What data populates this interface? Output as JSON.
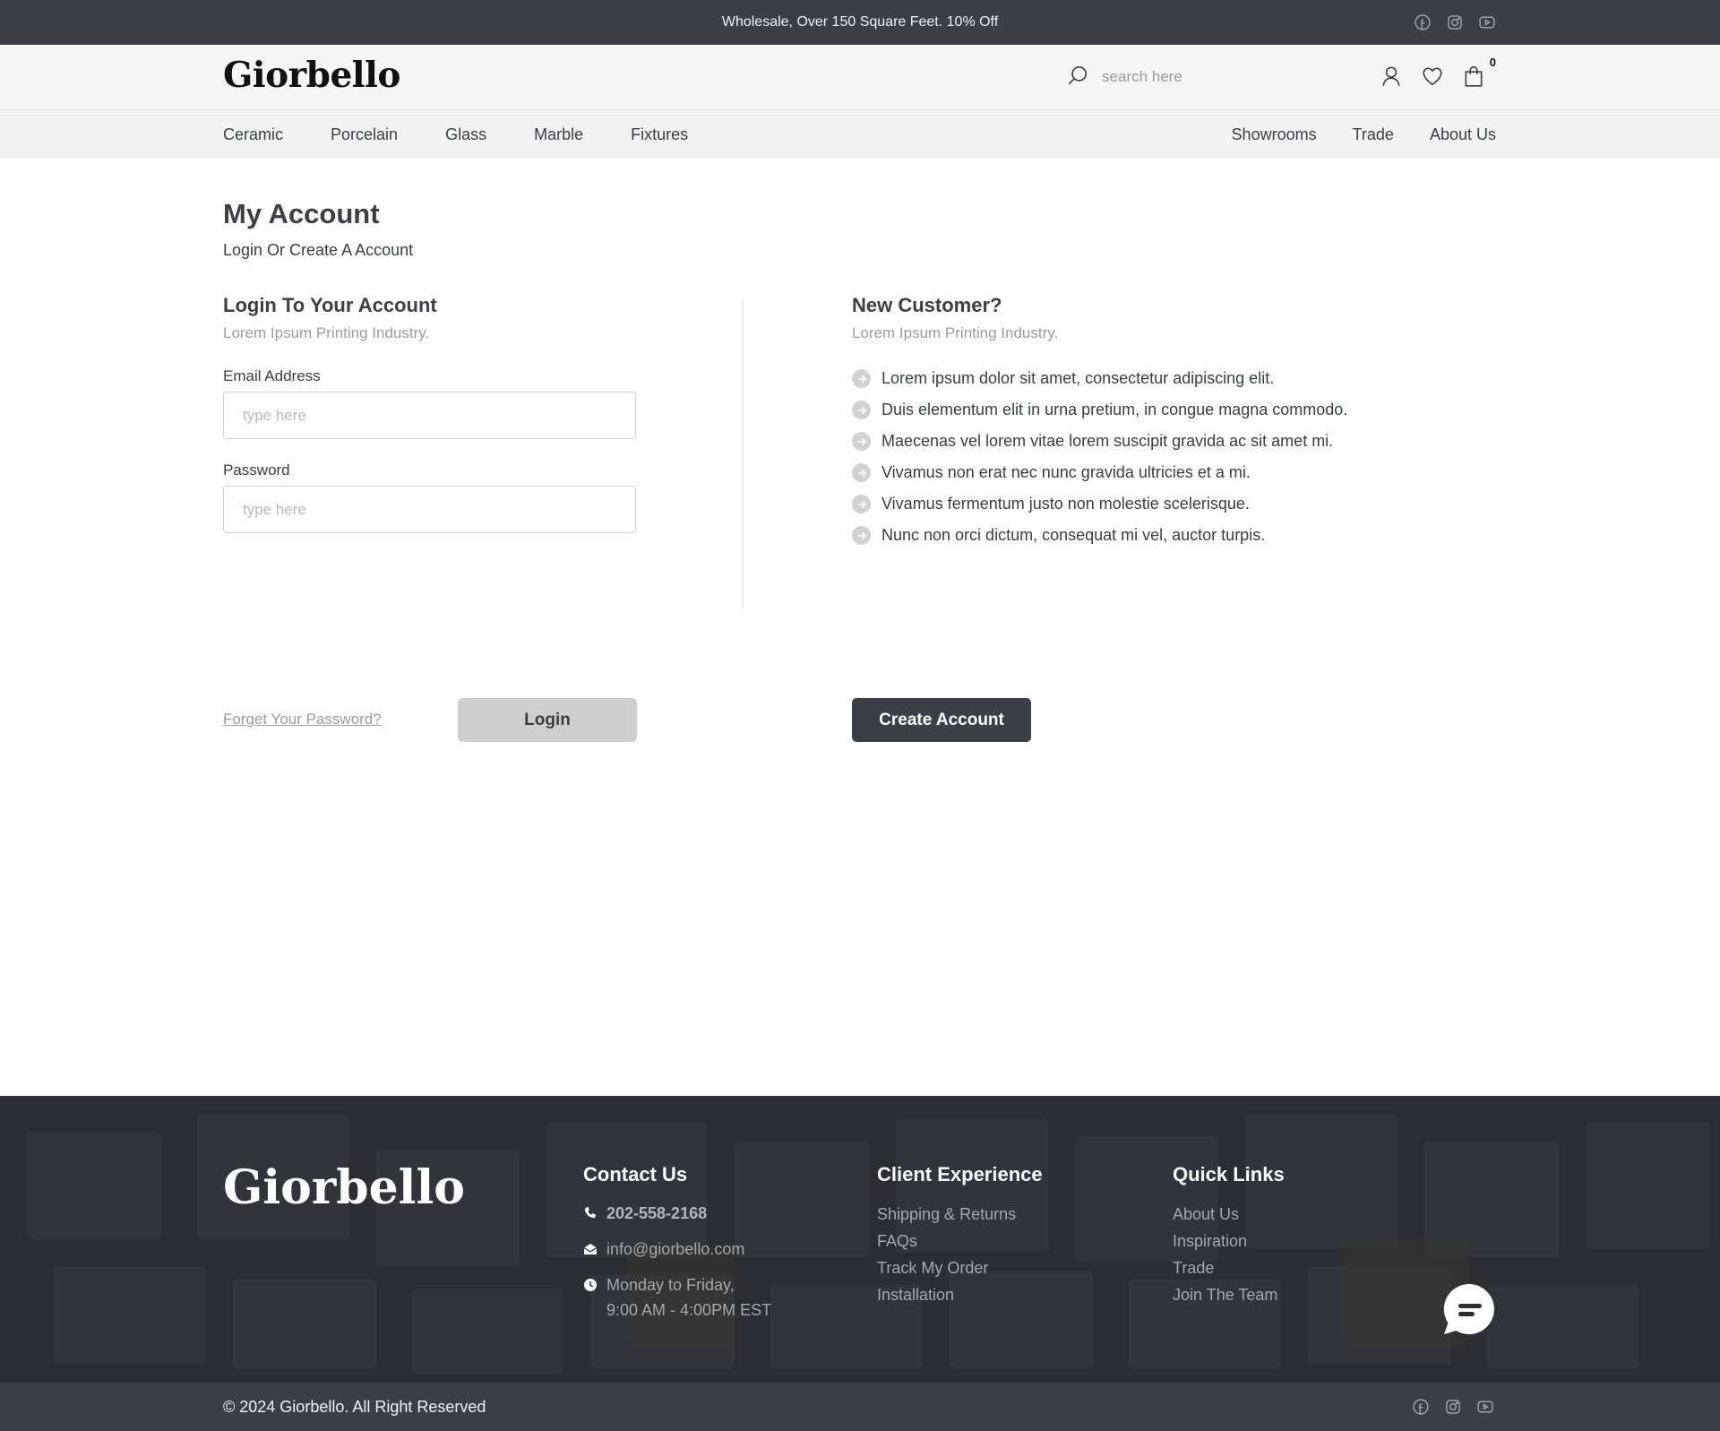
{
  "topbar": {
    "announcement": "Wholesale, Over 150 Square Feet. 10% Off",
    "social": [
      "facebook-icon",
      "instagram-icon",
      "youtube-icon"
    ]
  },
  "header": {
    "logo": "Giorbello",
    "search_placeholder": "search here",
    "cart_count": "0"
  },
  "nav": {
    "left": [
      "Ceramic",
      "Porcelain",
      "Glass",
      "Marble",
      "Fixtures"
    ],
    "right": [
      "Showrooms",
      "Trade",
      "About Us"
    ]
  },
  "page": {
    "title": "My Account",
    "subtitle": "Login Or Create A Account"
  },
  "login": {
    "title": "Login To Your Account",
    "subtitle": "Lorem Ipsum Printing Industry.",
    "email_label": "Email Address",
    "email_placeholder": "type here",
    "email_value": "",
    "password_label": "Password",
    "password_placeholder": "type here",
    "password_value": "",
    "forgot_label": "Forget Your Password?",
    "button_label": "Login"
  },
  "new_customer": {
    "title": "New Customer?",
    "subtitle": "Lorem Ipsum Printing Industry.",
    "benefits": [
      "Lorem ipsum dolor sit amet, consectetur adipiscing elit.",
      "Duis elementum elit in urna pretium, in congue magna commodo.",
      "Maecenas vel lorem vitae lorem suscipit gravida ac sit amet mi.",
      "Vivamus non erat nec nunc gravida ultricies et a mi.",
      "Vivamus fermentum justo non molestie scelerisque.",
      "Nunc non orci dictum, consequat mi vel, auctor turpis."
    ],
    "button_label": "Create Account"
  },
  "footer": {
    "logo": "Giorbello",
    "contact": {
      "title": "Contact Us",
      "phone": "202-558-2168",
      "email": "info@giorbello.com",
      "hours_line1": "Monday to Friday,",
      "hours_line2": "9:00 AM - 4:00PM EST"
    },
    "client_experience": {
      "title": "Client Experience",
      "links": [
        "Shipping & Returns",
        "FAQs",
        "Track My Order",
        "Installation"
      ]
    },
    "quick_links": {
      "title": "Quick Links",
      "links": [
        "About Us",
        "Inspiration",
        "Trade",
        "Join The Team"
      ]
    },
    "copyright": "© 2024 Giorbello. All Right Reserved"
  },
  "colors": {
    "dark": "#3c3f46",
    "footer_bg": "#2b2d33",
    "muted_text": "#9a9ca0",
    "login_button_bg": "#cfcfcf"
  }
}
